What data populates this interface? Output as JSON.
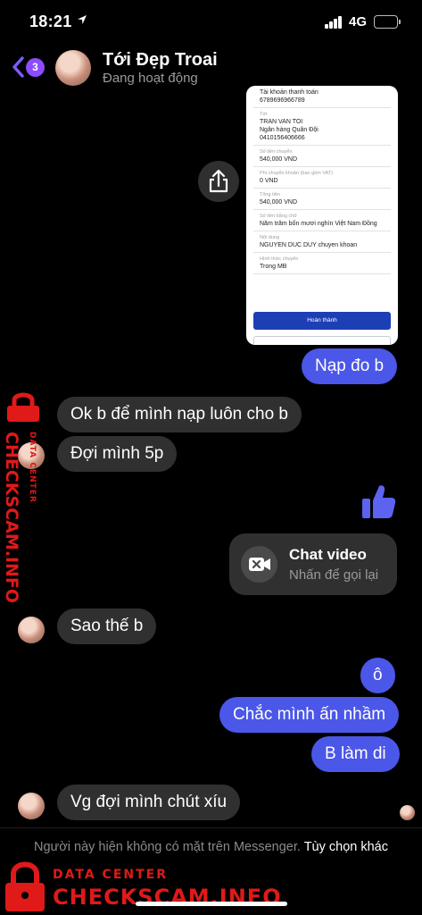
{
  "status_bar": {
    "time": "18:21",
    "network": "4G",
    "icons": [
      "location-arrow-icon",
      "signal-bars-icon",
      "battery-icon"
    ]
  },
  "header": {
    "unread_count": "3",
    "contact_name": "Tới Đẹp Troai",
    "presence": "Đang hoạt động",
    "back_icon": "chevron-left-icon"
  },
  "receipt": {
    "rows": [
      {
        "label": "",
        "value": "Tài khoản thanh toán\n6789696966789"
      },
      {
        "label": "Tới",
        "value": "TRAN VAN TOI\nNgân hàng Quân Đội\n0410156406666"
      },
      {
        "label": "Số tiền chuyển",
        "value": "540,000 VND"
      },
      {
        "label": "Phí chuyển khoản (bao gồm VAT)",
        "value": "0 VND"
      },
      {
        "label": "Tổng tiền",
        "value": "540,000 VND"
      },
      {
        "label": "Số tiền bằng chữ",
        "value": "Năm trăm bốn mươi nghìn Việt Nam Đồng"
      },
      {
        "label": "Nội dung",
        "value": "NGUYEN DUC DUY chuyen khoan"
      },
      {
        "label": "Hình thức chuyển",
        "value": "Trong MB"
      }
    ],
    "button_label": "Hoàn thành"
  },
  "messages": {
    "m1": "Nạp đo b",
    "m2": "Ok b để mình nạp luôn cho b",
    "m3": "Đợi mình 5p",
    "m4": "Sao thế b",
    "m5": "ô",
    "m6": "Chắc mình ấn nhầm",
    "m7": "B làm di",
    "m8": "Vg đợi mình chút xíu"
  },
  "video_call": {
    "title": "Chat video",
    "subtitle": "Nhấn để gọi lại",
    "icon": "video-camera-missed-icon"
  },
  "footer": {
    "notice": "Người này hiện không có mặt trên Messenger.",
    "action": "Tùy chọn khác"
  },
  "watermark": {
    "small": "DATA CENTER",
    "big": "CHECKSCAM.INFO"
  },
  "colors": {
    "accent": "#4b57e8",
    "incoming": "#303030",
    "watermark": "#e01919",
    "badge": "#8a4dff"
  }
}
